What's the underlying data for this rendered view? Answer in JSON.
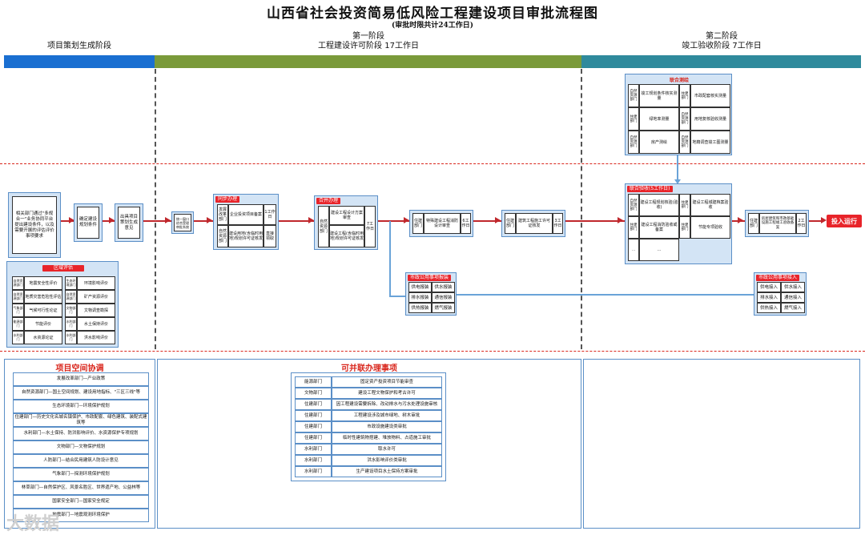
{
  "header": {
    "title": "山西省社会投资简易低风险工程建设项目审批流程图",
    "subtitle": "(审批时限共计24工作日)"
  },
  "phases": {
    "p0": {
      "name": "项目策划生成阶段",
      "color": "#1a6fd1"
    },
    "p1": {
      "stage": "第一阶段",
      "name": "工程建设许可阶段 17工作日",
      "color": "#7a9a3a"
    },
    "p2": {
      "stage": "第二阶段",
      "name": "竣工验收阶段 7工作日",
      "color": "#2f8a9c"
    }
  },
  "planning": {
    "start": "相关部门通过\"多规合一\"业务协同平台提出建设条件，以及需要开展的评估评价事项要求",
    "step1": "确定建设规划条件",
    "step2": "出具项目策划生成意见"
  },
  "regional": {
    "tag": "区域评估",
    "left": [
      {
        "dept": "自然资源部门",
        "item": "地震安全性评价"
      },
      {
        "dept": "自然资源部门",
        "item": "地质灾害危险性评估"
      },
      {
        "dept": "气象部门",
        "item": "气候可行性论证"
      },
      {
        "dept": "能源部门",
        "item": "节能评价"
      },
      {
        "dept": "水利部门",
        "item": "水资源论证"
      }
    ],
    "right": [
      {
        "dept": "生态环境部门",
        "item": "环境影响评价"
      },
      {
        "dept": "自然资源部门",
        "item": "矿产资源评价"
      },
      {
        "dept": "文物部门",
        "item": "文物调查勘探"
      },
      {
        "dept": "水利部门",
        "item": "水土保持评价"
      },
      {
        "dept": "水利部门",
        "item": "洪水影响评价"
      }
    ]
  },
  "portal": "统一窗口综合受理审批系统",
  "parallel1": {
    "tag": "同步办理",
    "row1": {
      "dept": "发展改革部门",
      "item": "企业投资项目备案",
      "days": "1工作日"
    },
    "row2": {
      "dept": "自然资源部门",
      "item": "建设用地(含临时用地)规划许可证核发",
      "days": "直接领取"
    }
  },
  "merged": {
    "tag": "合并办理",
    "dept": "自然资源部门",
    "item1": "建设工程设计方案审查",
    "item2": "建设工程(含临时用地)规划许可证核发",
    "days": "7工作日"
  },
  "fire": {
    "dept": "住建部门",
    "item": "特殊建设工程消防设计审查",
    "days": "6工作日"
  },
  "permit": {
    "dept": "住建部门",
    "item": "建筑工程施工许可证核发",
    "days": "3工作日"
  },
  "utilities1": {
    "tag": "市政公用事项报装",
    "items": [
      "供电报装",
      "供水报装",
      "排水报装",
      "通信报装",
      "供热报装",
      "燃气报装"
    ]
  },
  "survey": {
    "tag": "联合测绘",
    "items": [
      {
        "dept": "自然资源部门",
        "item": "竣工规划条件核实测量"
      },
      {
        "dept": "住建部门",
        "item": "市政配套核实测量"
      },
      {
        "dept": "住建部门",
        "item": "绿地率测量"
      },
      {
        "dept": "自然资源部门",
        "item": "用地复核验收测量"
      },
      {
        "dept": "自然资源部门",
        "item": "房产测绘"
      },
      {
        "dept": "自然资源部门",
        "item": "地籍调查竣工图测量"
      }
    ]
  },
  "acceptance": {
    "tag": "联合验收(5工作日)",
    "items": [
      {
        "dept": "自然资源部门",
        "item": "建设工程规划核验(验收)"
      },
      {
        "dept": "住建部门",
        "item": "建设工程城建档案验收"
      },
      {
        "dept": "住建部门",
        "item": "建设工程消防验收或备案"
      },
      {
        "dept": "住建部门",
        "item": "节能专项验收"
      },
      {
        "dept": "…",
        "item": "…"
      }
    ]
  },
  "registration": {
    "dept": "住建部门",
    "item": "房屋建筑和市政基础设施工程竣工验收备案",
    "days": "2工作日"
  },
  "operate": "投入运行",
  "utilities2": {
    "tag": "市政公用事项接入",
    "items": [
      "供电接入",
      "供水接入",
      "排水接入",
      "通信接入",
      "供热接入",
      "燃气接入"
    ]
  },
  "coord": {
    "title": "项目空间协调",
    "items": [
      "发展改革部门—产业政策",
      "自然资源部门—国土空间规划、建设用地指标、\"三区三线\"等",
      "生态环境部门—环境保护规划",
      "住建部门—历史文化名城名镇保护、市政配套、绿色建筑、装配式建筑等",
      "水利部门—水土保持、防洪影响评价、水资源保护专项规划",
      "文物部门—文物保护规划",
      "人防部门—结合民用建筑人防设计意见",
      "气象部门—探测环境保护规划",
      "林草部门—自然保护区、风景名胜区、世界遗产地、公益林等",
      "国家安全部门—国家安全规定",
      "地震部门—地震观测环境保护"
    ]
  },
  "parallel_items": {
    "title": "可并联办理事项",
    "rows": [
      {
        "dept": "能源部门",
        "item": "固定资产投资项目节能审查"
      },
      {
        "dept": "文物部门",
        "item": "建设工程文物保护和考古许可"
      },
      {
        "dept": "住建部门",
        "item": "因工程建设需要拆除、改动排水与污水处理设施审核"
      },
      {
        "dept": "住建部门",
        "item": "工程建设涉及城市绿地、树木审批"
      },
      {
        "dept": "住建部门",
        "item": "市政设施建设类审批"
      },
      {
        "dept": "住建部门",
        "item": "临时性建筑物搭建、堆放物料、占道施工审批"
      },
      {
        "dept": "水利部门",
        "item": "取水许可"
      },
      {
        "dept": "水利部门",
        "item": "洪水影响评价类审批"
      },
      {
        "dept": "水利部门",
        "item": "生产建设项目水土保持方案审批"
      }
    ]
  },
  "watermark": "大数据"
}
